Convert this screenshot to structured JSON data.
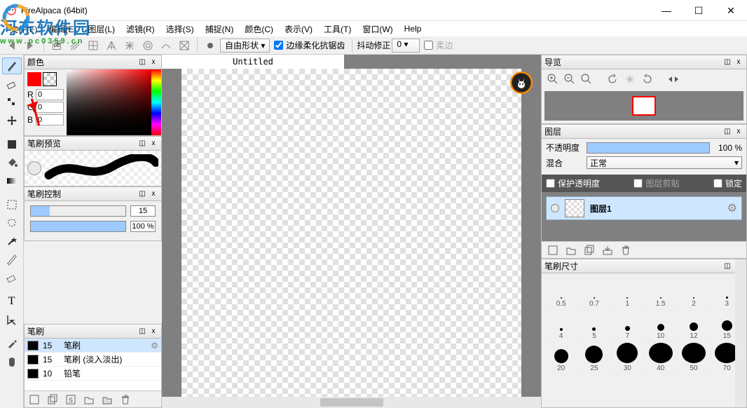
{
  "window": {
    "title": "FireAlpaca (64bit)",
    "min": "—",
    "max": "☐",
    "close": "✕"
  },
  "watermark": {
    "line1": "河东软件园",
    "line2": "www.pc0359.cn"
  },
  "menu": [
    "文件(F)",
    "编辑(E)",
    "图层(L)",
    "滤镜(R)",
    "选择(S)",
    "捕捉(N)",
    "颜色(C)",
    "表示(V)",
    "工具(T)",
    "窗口(W)",
    "Help"
  ],
  "toolbar": {
    "shape_mode": "自由形状",
    "aa_label": "边缘柔化抗锯齿",
    "aa": true,
    "stabilizer_label": "抖动修正",
    "stabilizer_value": "0",
    "soft_label": "柔边",
    "soft": false
  },
  "panels": {
    "color": {
      "title": "颜色",
      "r_label": "R",
      "g_label": "G",
      "b_label": "B",
      "r": "0",
      "g": "0",
      "b": "0",
      "fg": "#ff0000"
    },
    "brush_preview": {
      "title": "笔刷预览"
    },
    "brush_control": {
      "title": "笔刷控制",
      "size": "15",
      "opacity": "100 %",
      "size_pct": 20,
      "opacity_pct": 100
    },
    "brushes": {
      "title": "笔刷",
      "items": [
        {
          "size": "15",
          "name": "笔刷",
          "active": true
        },
        {
          "size": "15",
          "name": "笔刷 (淡入淡出)",
          "active": false
        },
        {
          "size": "10",
          "name": "铅笔",
          "active": false
        }
      ]
    },
    "navigator": {
      "title": "导览"
    },
    "layers": {
      "title": "图层",
      "opacity_label": "不透明度",
      "opacity_value": "100 %",
      "opacity_pct": 100,
      "blend_label": "混合",
      "blend_value": "正常",
      "protect_label": "保护透明度",
      "clip_label": "图层剪贴",
      "lock_label": "锁定",
      "items": [
        {
          "name": "图层1"
        }
      ]
    },
    "brush_size": {
      "title": "笔刷尺寸",
      "values": [
        "0.5",
        "0.7",
        "1",
        "1.5",
        "2",
        "3",
        "4",
        "5",
        "7",
        "10",
        "12",
        "15",
        "20",
        "25",
        "30",
        "40",
        "50",
        "70"
      ]
    }
  },
  "canvas": {
    "tab": "Untitled"
  },
  "icons": {
    "dock": "◫",
    "close_small": "x",
    "gear": "⚙",
    "drop": "▾",
    "zoom_in": "⊕",
    "zoom_out": "⊖",
    "zoom_fit": "🔍",
    "rot_l": "↶",
    "rot_reset": "✳",
    "rot_r": "↷",
    "flip": "▶|"
  }
}
